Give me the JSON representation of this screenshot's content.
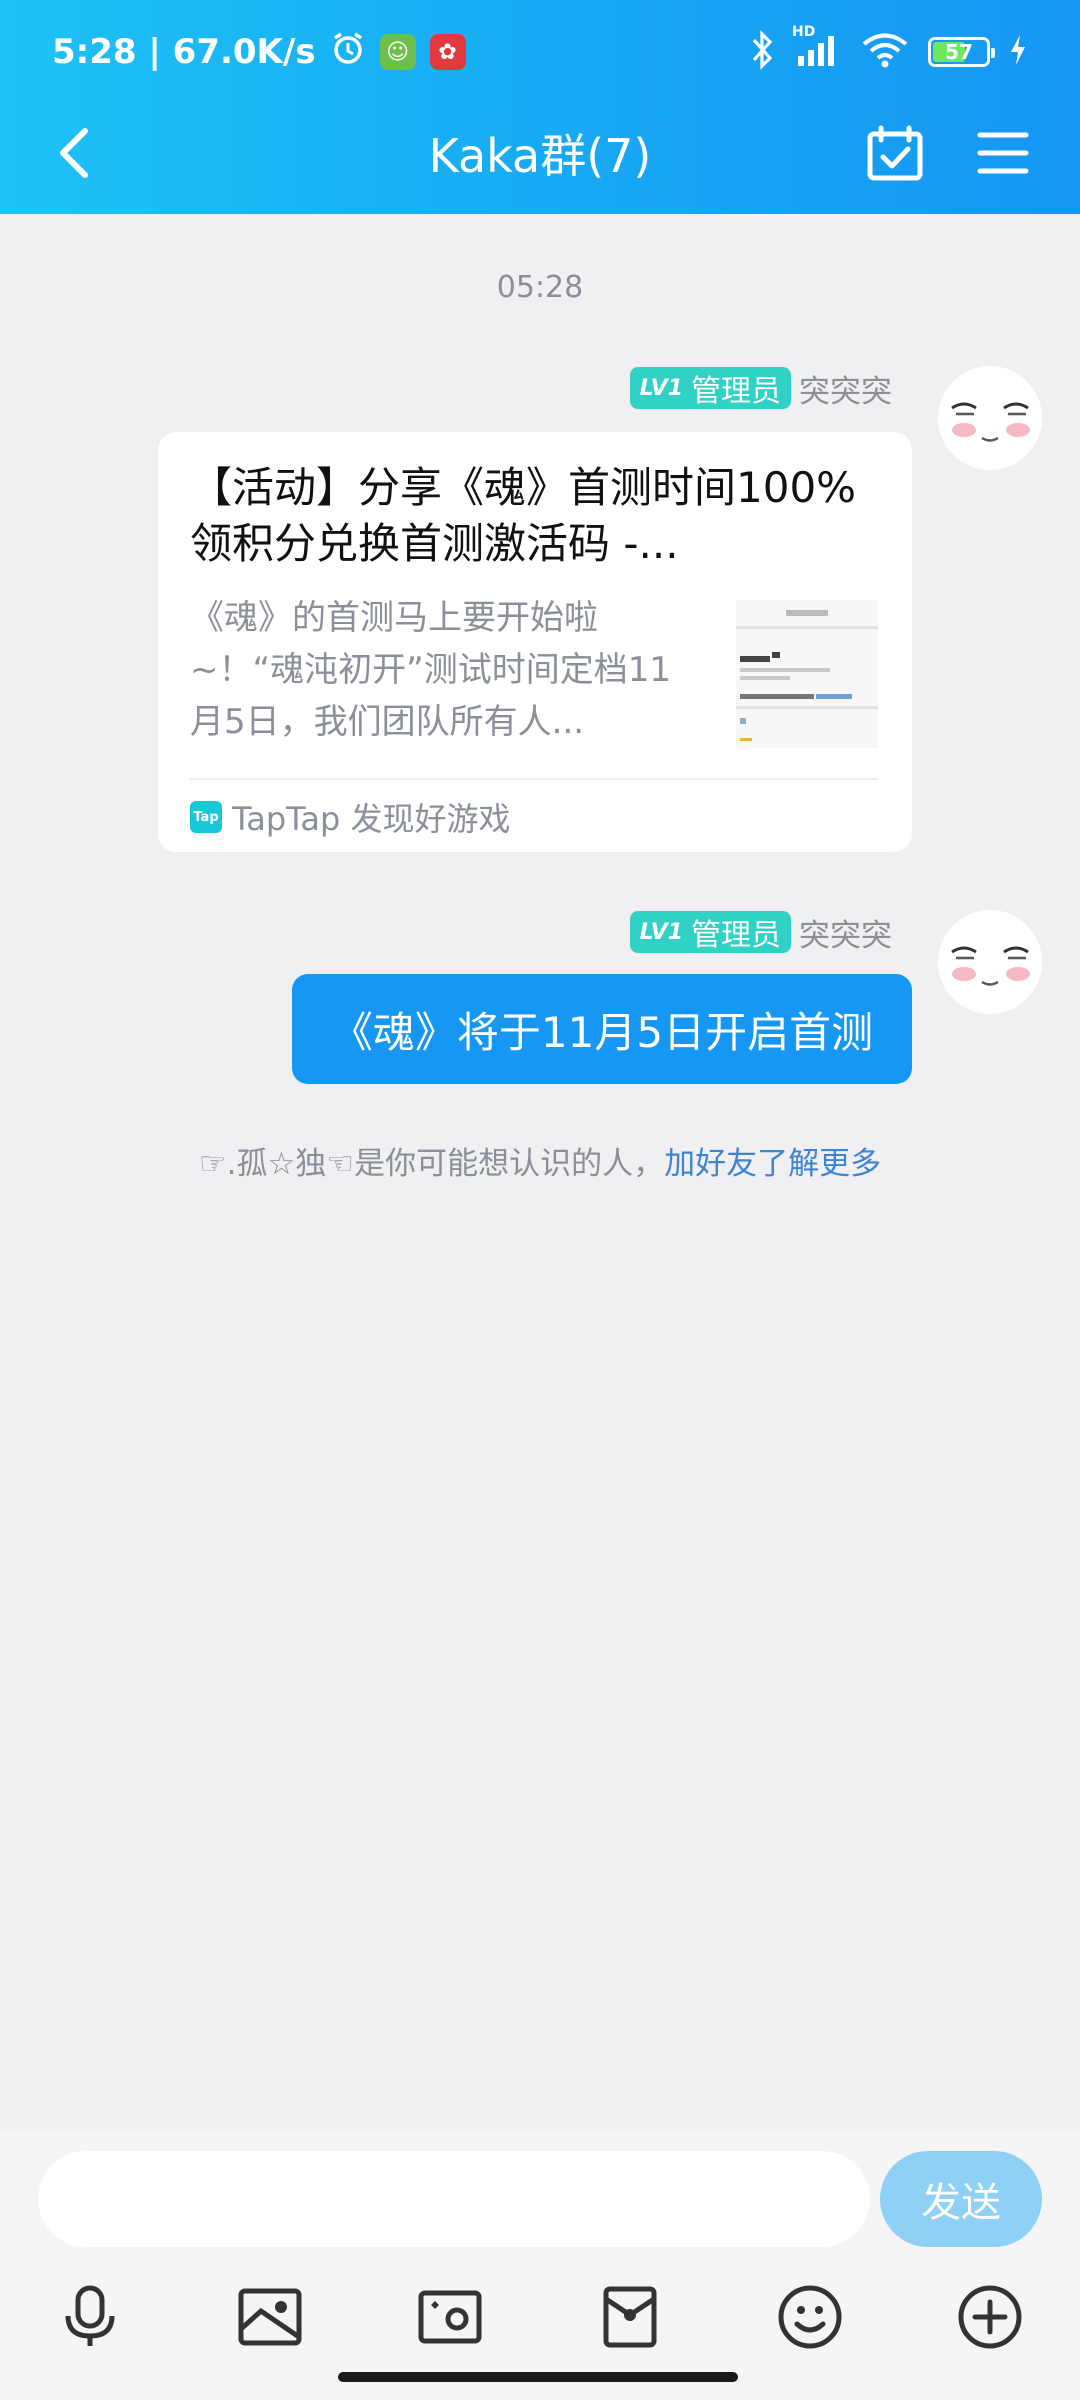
{
  "status_bar": {
    "time_speed": "5:28 | 67.0K/s",
    "battery": "57",
    "network": "HD"
  },
  "header": {
    "title": "Kaka群(7)"
  },
  "chat": {
    "timestamp": "05:28",
    "messages": [
      {
        "sender_level": "LV1",
        "sender_role": "管理员",
        "sender_name": "突突突",
        "card": {
          "title": "【活动】分享《魂》首测时间100%领积分兑换首测激活码 -...",
          "description": "《魂》的首测马上要开始啦~！“魂沌初开”测试时间定档11月5日，我们团队所有人...",
          "source": "TapTap 发现好游戏",
          "source_icon_text": "Tap"
        }
      },
      {
        "sender_level": "LV1",
        "sender_role": "管理员",
        "sender_name": "突突突",
        "text": "《魂》将于11月5日开启首测"
      }
    ],
    "system_tip": {
      "prefix": "☞.孤☆独☜是你可能想认识的人，",
      "link": "加好友了解更多"
    }
  },
  "input": {
    "value": "",
    "placeholder": "",
    "send_label": "发送"
  },
  "toolbar": {
    "icons": [
      "microphone-icon",
      "image-icon",
      "camera-icon",
      "red-packet-icon",
      "emoji-icon",
      "plus-icon"
    ]
  }
}
